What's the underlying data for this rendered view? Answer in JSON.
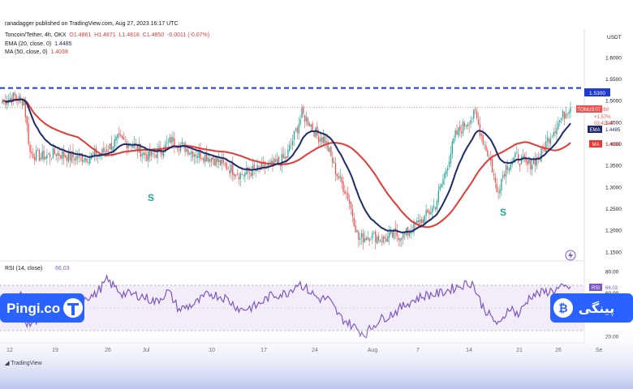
{
  "header": {
    "publisher": "ranadagger published on TradingView.com, Aug 27, 2023 16:17 UTC",
    "symbol_line": "Toncoin/Tether, 4h, OKX",
    "ohlc": {
      "o": "O1.4861",
      "h": "H1.4871",
      "l": "L1.4818",
      "c": "C1.4850",
      "chg": "-0.0011 (-0.07%)"
    },
    "ema_line": "EMA (20, close, 0)",
    "ema_value": "1.4485",
    "ma_line": "MA (50, close, 0)",
    "ma_value": "1.4038"
  },
  "axis": {
    "currency": "USDT",
    "price_ticks": [
      "1.6000",
      "1.5500",
      "1.5000",
      "1.4500",
      "1.4000",
      "1.3500",
      "1.3000",
      "1.2500",
      "1.2000",
      "1.1500"
    ],
    "rsi_ticks": [
      "80.00",
      "60.00",
      "40.00",
      "20.00"
    ],
    "time_ticks": [
      "12",
      "19",
      "26",
      "Jul",
      "10",
      "17",
      "24",
      "Aug",
      "7",
      "14",
      "21",
      "26",
      "Se"
    ]
  },
  "labels": {
    "level_tag": "1.5300",
    "symbol_tag": "TONUSDT",
    "price_tag": "1.4850",
    "pct_tag": "+1.57%",
    "countdown_tag": "03:42:48",
    "ema_tag_name": "EMA",
    "ema_tag_value": "1.4485",
    "ma_tag_name": "MA",
    "ma_tag_value": "1.4038",
    "rsi_tag_name": "RSI",
    "rsi_tag_value": "66.03",
    "s_left": "S",
    "s_right": "S",
    "rsi_header": "RSI (14, close)",
    "rsi_header_value": "66.03",
    "tv_footer": "TradingView",
    "brand_left": "Pingi.co",
    "brand_right": "پینگی"
  },
  "colors": {
    "up": "#26a69a",
    "down": "#ef5350",
    "ema": "#1f2a6b",
    "ma": "#e53935",
    "level": "#1e3ad6",
    "rsi": "#7e57c2",
    "brand": "#2962ff"
  },
  "chart_data": {
    "type": "candlestick",
    "price_range": [
      1.13,
      1.64
    ],
    "rsi_range": [
      15,
      90
    ],
    "resistance_level": 1.53,
    "x_index_range": [
      0,
      370
    ],
    "price_anchors": [
      [
        0,
        1.5
      ],
      [
        8,
        1.51
      ],
      [
        14,
        1.5
      ],
      [
        18,
        1.38
      ],
      [
        25,
        1.37
      ],
      [
        35,
        1.38
      ],
      [
        45,
        1.37
      ],
      [
        55,
        1.37
      ],
      [
        65,
        1.38
      ],
      [
        75,
        1.41
      ],
      [
        85,
        1.4
      ],
      [
        95,
        1.37
      ],
      [
        105,
        1.39
      ],
      [
        110,
        1.41
      ],
      [
        115,
        1.4
      ],
      [
        125,
        1.38
      ],
      [
        135,
        1.37
      ],
      [
        145,
        1.35
      ],
      [
        155,
        1.33
      ],
      [
        165,
        1.34
      ],
      [
        175,
        1.35
      ],
      [
        185,
        1.37
      ],
      [
        195,
        1.47
      ],
      [
        200,
        1.45
      ],
      [
        205,
        1.42
      ],
      [
        210,
        1.41
      ],
      [
        218,
        1.33
      ],
      [
        225,
        1.28
      ],
      [
        232,
        1.18
      ],
      [
        240,
        1.19
      ],
      [
        248,
        1.18
      ],
      [
        255,
        1.19
      ],
      [
        262,
        1.19
      ],
      [
        268,
        1.21
      ],
      [
        275,
        1.23
      ],
      [
        282,
        1.26
      ],
      [
        288,
        1.33
      ],
      [
        295,
        1.42
      ],
      [
        302,
        1.45
      ],
      [
        308,
        1.47
      ],
      [
        312,
        1.42
      ],
      [
        318,
        1.36
      ],
      [
        322,
        1.29
      ],
      [
        328,
        1.35
      ],
      [
        335,
        1.37
      ],
      [
        342,
        1.35
      ],
      [
        350,
        1.37
      ],
      [
        355,
        1.41
      ],
      [
        362,
        1.45
      ],
      [
        370,
        1.49
      ]
    ],
    "rsi_anchors": [
      [
        0,
        40
      ],
      [
        6,
        52
      ],
      [
        12,
        58
      ],
      [
        16,
        30
      ],
      [
        22,
        36
      ],
      [
        30,
        45
      ],
      [
        40,
        55
      ],
      [
        50,
        56
      ],
      [
        60,
        58
      ],
      [
        68,
        72
      ],
      [
        78,
        60
      ],
      [
        90,
        58
      ],
      [
        100,
        52
      ],
      [
        108,
        62
      ],
      [
        115,
        45
      ],
      [
        125,
        50
      ],
      [
        135,
        60
      ],
      [
        145,
        56
      ],
      [
        155,
        45
      ],
      [
        165,
        48
      ],
      [
        175,
        58
      ],
      [
        185,
        60
      ],
      [
        193,
        70
      ],
      [
        200,
        62
      ],
      [
        206,
        55
      ],
      [
        212,
        55
      ],
      [
        220,
        38
      ],
      [
        230,
        28
      ],
      [
        236,
        22
      ],
      [
        245,
        35
      ],
      [
        255,
        42
      ],
      [
        265,
        52
      ],
      [
        275,
        58
      ],
      [
        285,
        60
      ],
      [
        292,
        64
      ],
      [
        300,
        68
      ],
      [
        306,
        70
      ],
      [
        312,
        50
      ],
      [
        318,
        38
      ],
      [
        324,
        30
      ],
      [
        330,
        48
      ],
      [
        336,
        40
      ],
      [
        344,
        58
      ],
      [
        350,
        60
      ],
      [
        356,
        62
      ],
      [
        362,
        64
      ],
      [
        370,
        66
      ]
    ],
    "ema20_value": 1.4485,
    "ma50_value": 1.4038,
    "rsi_value": 66.03
  }
}
